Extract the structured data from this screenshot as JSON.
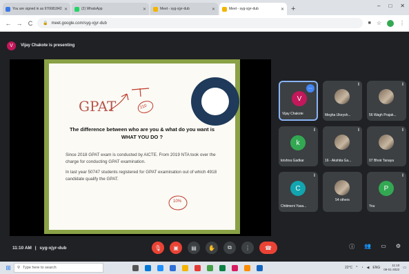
{
  "browser": {
    "tabs": [
      {
        "label": "You are signed in as 9766818422",
        "color": "#3b78e7",
        "active": false
      },
      {
        "label": "(2) WhatsApp",
        "color": "#25d366",
        "active": false
      },
      {
        "label": "Meet - syg-xjyr-dub",
        "color": "#f4b400",
        "active": false
      },
      {
        "label": "Meet - syg-xjyr-dub",
        "color": "#f4b400",
        "active": true
      }
    ],
    "new_tab": "+",
    "url": "meet.google.com/syg-xjyr-dub",
    "window_controls": [
      "–",
      "□",
      "✕"
    ]
  },
  "presenting": {
    "avatar": "V",
    "text": "Vijay Chakote is presenting"
  },
  "slide": {
    "gpat": "GPAT",
    "heading_line1": "The difference between who are you & what do you want is",
    "heading_line2": "WHAT YOU DO ?",
    "para1": "Since 2018 GPAT exam is conducted by AICTE. From 2019 NTA took over the charge for conducting GPAT examination.",
    "para2": "In last year 50747 students registered for GPAT examination out of which 4918 candidate qualify the GPAT.",
    "logo_text": "PHARMASTAR ACADEMY",
    "annotation_1": "210",
    "annotation_2": "10%"
  },
  "participants": [
    {
      "name": "Vijay Chakote",
      "avatar": "V",
      "color": "#c2185b",
      "photo": false,
      "pinned": true
    },
    {
      "name": "Megha Ukeysh...",
      "photo": true
    },
    {
      "name": "56 Wagh Prajak...",
      "photo": true
    },
    {
      "name": "krishna Gadkar",
      "avatar": "k",
      "color": "#33a852",
      "photo": false
    },
    {
      "name": "16 - Akshita Ga...",
      "photo": true
    },
    {
      "name": "07 Bhoir Tanaya",
      "photo": true
    },
    {
      "name": "Chitimeni Yasa...",
      "avatar": "C",
      "color": "#12a4af",
      "photo": false
    },
    {
      "name": "54 others",
      "photo": true
    },
    {
      "name": "You",
      "avatar": "P",
      "color": "#33a852",
      "photo": false
    }
  ],
  "meeting": {
    "time": "11:10 AM",
    "separator": "|",
    "code": "syg-xjyr-dub"
  },
  "taskbar": {
    "search_placeholder": "Type here to search",
    "temp": "22°C",
    "lang": "ENG",
    "time": "11:10",
    "date": "08-01-2022"
  }
}
